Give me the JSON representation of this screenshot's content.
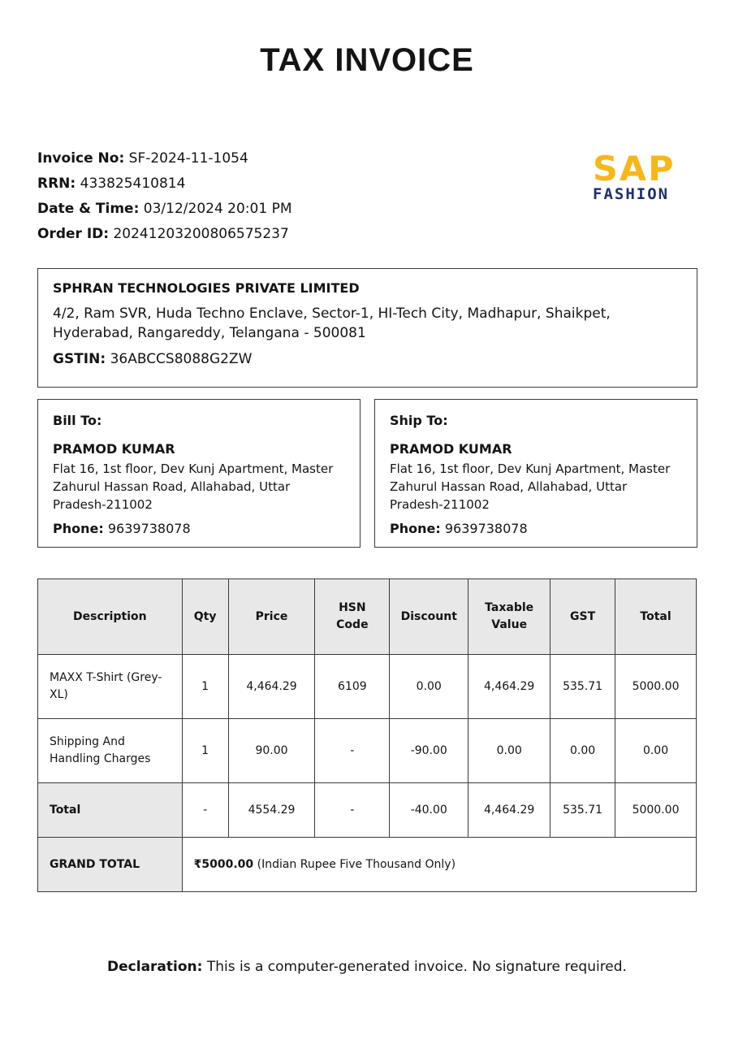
{
  "title": "TAX INVOICE",
  "meta": {
    "invoice_no_label": "Invoice No:",
    "invoice_no": "SF-2024-11-1054",
    "rrn_label": "RRN:",
    "rrn": "433825410814",
    "datetime_label": "Date & Time:",
    "datetime": "03/12/2024 20:01 PM",
    "order_label": "Order ID:",
    "order_id": "20241203200806575237"
  },
  "logo": {
    "top": "SAP",
    "bottom": "FASHION",
    "color_top": "#f7b71b",
    "color_bottom": "#1f2f6b"
  },
  "seller": {
    "name": "SPHRAN TECHNOLOGIES PRIVATE LIMITED",
    "address": "4/2, Ram SVR, Huda Techno Enclave, Sector-1, HI-Tech City, Madhapur, Shaikpet, Hyderabad, Rangareddy, Telangana - 500081",
    "gstin_label": "GSTIN:",
    "gstin": "36ABCCS8088G2ZW"
  },
  "bill_to": {
    "heading": "Bill To:",
    "name": "PRAMOD KUMAR",
    "address": "Flat 16, 1st floor, Dev Kunj Apartment, Master Zahurul Hassan Road, Allahabad, Uttar Pradesh-211002",
    "phone_label": "Phone:",
    "phone": "9639738078"
  },
  "ship_to": {
    "heading": "Ship To:",
    "name": "PRAMOD KUMAR",
    "address": "Flat 16, 1st floor, Dev Kunj Apartment, Master Zahurul Hassan Road, Allahabad, Uttar Pradesh-211002",
    "phone_label": "Phone:",
    "phone": "9639738078"
  },
  "table": {
    "headers": [
      "Description",
      "Qty",
      "Price",
      "HSN Code",
      "Discount",
      "Taxable Value",
      "GST",
      "Total"
    ],
    "rows": [
      [
        "MAXX T-Shirt (Grey-XL)",
        "1",
        "4,464.29",
        "6109",
        "0.00",
        "4,464.29",
        "535.71",
        "5000.00"
      ],
      [
        "Shipping And Handling Charges",
        "1",
        "90.00",
        "-",
        "-90.00",
        "0.00",
        "0.00",
        "0.00"
      ]
    ],
    "total_row": [
      "Total",
      "-",
      "4554.29",
      "-",
      "-40.00",
      "4,464.29",
      "535.71",
      "5000.00"
    ],
    "grand_total_label": "GRAND TOTAL",
    "grand_total_amount": "₹5000.00",
    "grand_total_words": " (Indian Rupee Five Thousand Only)"
  },
  "declaration": {
    "label": "Declaration:",
    "text": " This is a computer-generated invoice. No signature required."
  }
}
